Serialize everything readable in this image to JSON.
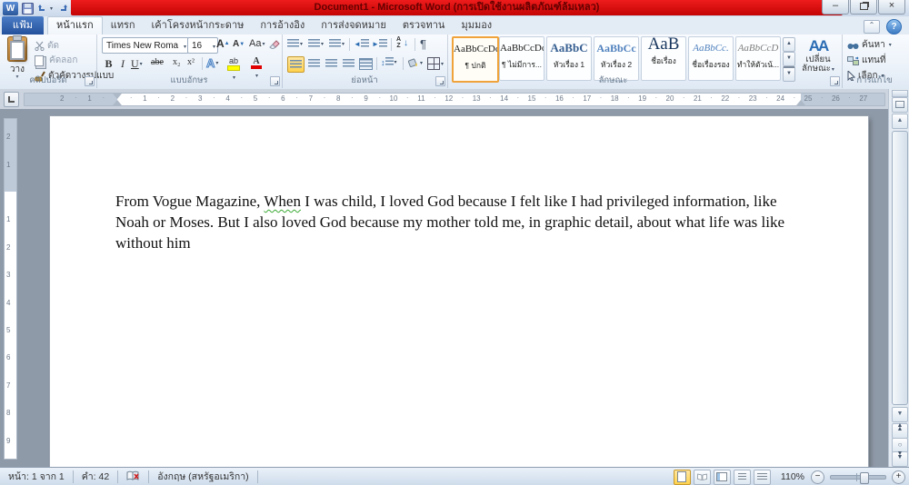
{
  "window": {
    "title": "Document1 - Microsoft Word (การเปิดใช้งานผลิตภัณฑ์ล้มเหลว)",
    "controls": {
      "minimize": "–",
      "close": "×"
    },
    "help": "?",
    "qat": {
      "logo": "W",
      "a_label": "A"
    }
  },
  "tabs": {
    "items": [
      {
        "label": "แฟ้ม"
      },
      {
        "label": "หน้าแรก"
      },
      {
        "label": "แทรก"
      },
      {
        "label": "เค้าโครงหน้ากระดาษ"
      },
      {
        "label": "การอ้างอิง"
      },
      {
        "label": "การส่งจดหมาย"
      },
      {
        "label": "ตรวจทาน"
      },
      {
        "label": "มุมมอง"
      }
    ]
  },
  "ribbon": {
    "clipboard": {
      "label": "คลิปบอร์ด",
      "paste": "วาง",
      "cut": "ตัด",
      "copy": "คัดลอก",
      "format_painter": "ตัวคัดวางรูปแบบ"
    },
    "font": {
      "label": "แบบอักษร",
      "font_name": "Times New Roma",
      "font_size": "16",
      "grow": "A",
      "shrink": "A",
      "change_case": "Aa",
      "bold": "B",
      "italic": "I",
      "underline": "U",
      "strike": "abe",
      "subscript": "x₂",
      "superscript": "x²",
      "effects": "A",
      "highlight": "ab",
      "font_color": "A"
    },
    "paragraph": {
      "label": "ย่อหน้า",
      "sort_a": "A",
      "sort_z": "Z",
      "pilcrow": "¶"
    },
    "styles": {
      "label": "ลักษณะ",
      "items": [
        {
          "preview": "AaBbCcDc",
          "name": "¶ ปกติ"
        },
        {
          "preview": "AaBbCcDc",
          "name": "¶ ไม่มีการ..."
        },
        {
          "preview": "AaBbC",
          "name": "หัวเรื่อง 1"
        },
        {
          "preview": "AaBbCc",
          "name": "หัวเรื่อง 2"
        },
        {
          "preview": "AaB",
          "name": "ชื่อเรื่อง"
        },
        {
          "preview": "AaBbCc.",
          "name": "ชื่อเรื่องรอง"
        },
        {
          "preview": "AaBbCcD",
          "name": "ทำให้ตัวเน้..."
        }
      ],
      "change_styles_big": "AA",
      "change_styles_line1": "เปลี่ยน",
      "change_styles_line2": "ลักษณะ"
    },
    "editing": {
      "label": "การแก้ไข",
      "find": "ค้นหา",
      "replace": "แทนที่",
      "select": "เลือก"
    }
  },
  "ruler": {
    "h_numbers_max": 27,
    "h_margin_numbers": [
      "1",
      "2"
    ],
    "v_numbers_max": 9,
    "v_margin_numbers": [
      "1",
      "2"
    ]
  },
  "document": {
    "text_before": "From Vogue Magazine, ",
    "text_flagged": "When",
    "text_after": " I was child, I loved God because I felt like I had privileged information, like Noah or Moses. But I also loved God because my mother told me, in graphic detail, about what life was like without him"
  },
  "status": {
    "page": "หน้า: 1 จาก 1",
    "words": "คำ: 42",
    "language": "อังกฤษ (สหรัฐอเมริกา)",
    "zoom_level": "110%",
    "zoom_minus": "−",
    "zoom_plus": "+"
  }
}
